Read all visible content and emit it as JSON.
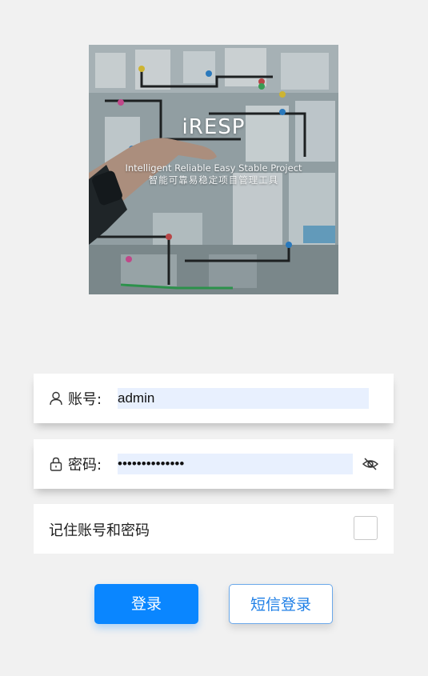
{
  "hero": {
    "brand": "iRESP",
    "tagline_en": "Intelligent Reliable Easy Stable Project",
    "tagline_zh": "智能可靠易稳定项目管理工具"
  },
  "form": {
    "account": {
      "icon": "user-icon",
      "label": "账号:",
      "value": "admin"
    },
    "password": {
      "icon": "lock-icon",
      "label": "密码:",
      "value": "••••••••••••••",
      "toggle_icon": "eye-off-icon"
    },
    "remember": {
      "label": "记住账号和密码",
      "checked": false
    }
  },
  "buttons": {
    "login": "登录",
    "sms_login": "短信登录"
  },
  "colors": {
    "primary": "#0a86ff",
    "background": "#f1f1f1",
    "autofill": "#e8f0fe"
  }
}
